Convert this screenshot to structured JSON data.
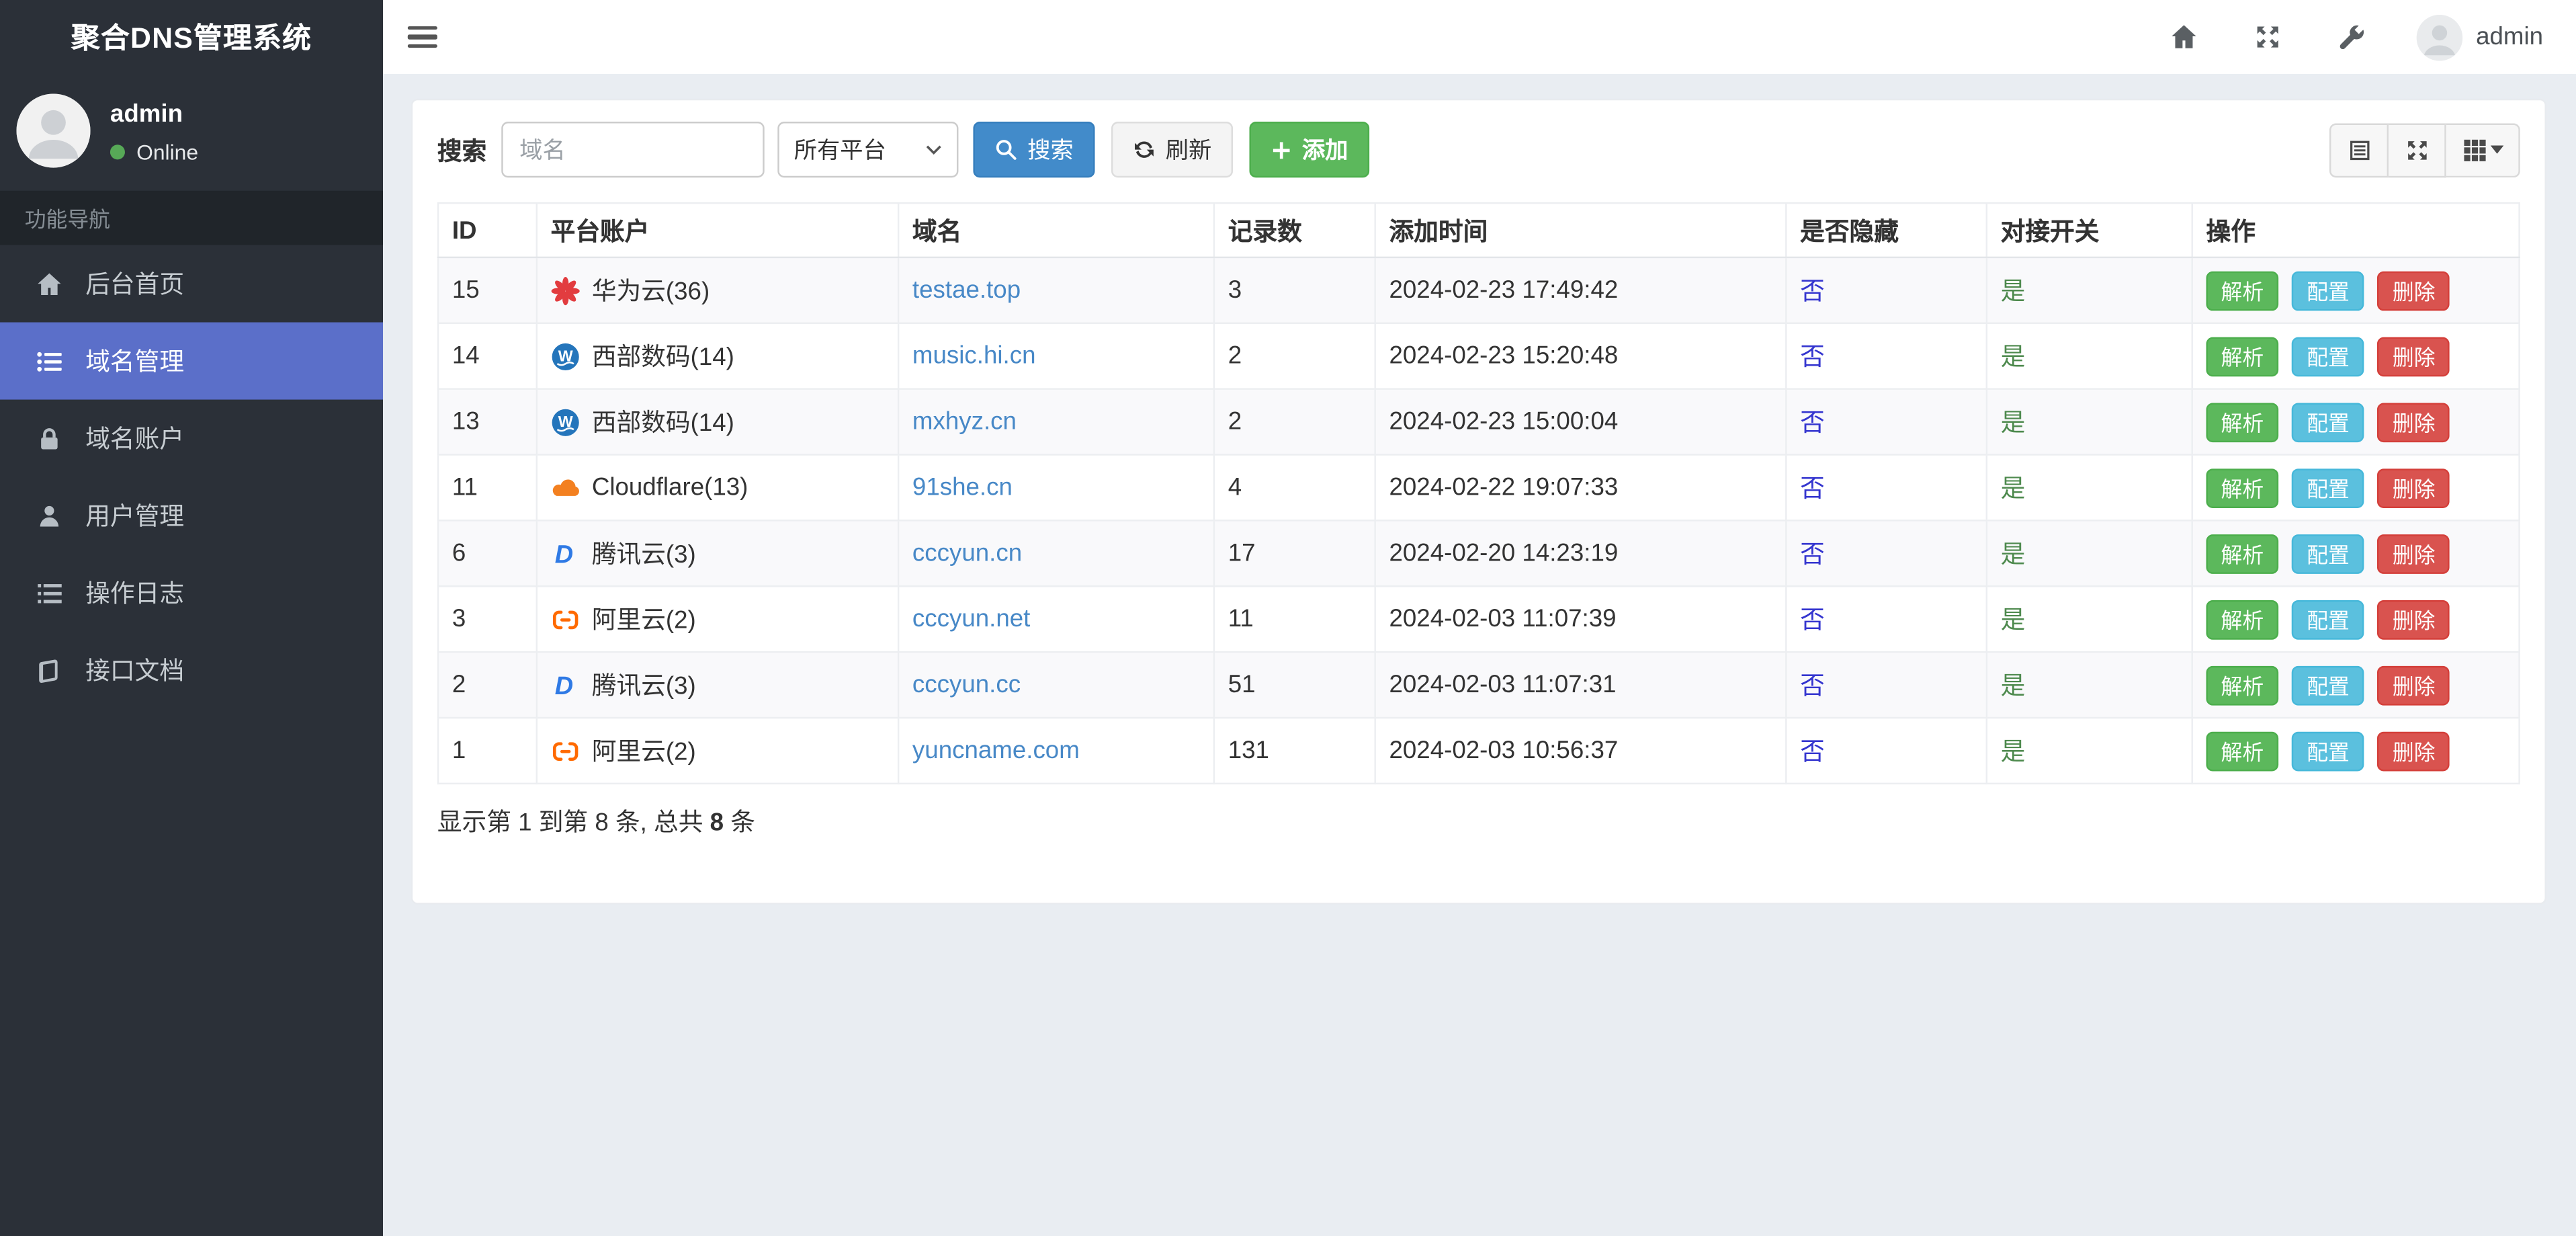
{
  "app_title": "聚合DNS管理系统",
  "topbar": {
    "user_name": "admin"
  },
  "sidebar": {
    "user_name": "admin",
    "user_status": "Online",
    "section_label": "功能导航",
    "items": [
      {
        "label": "后台首页",
        "icon": "home-icon",
        "active": false
      },
      {
        "label": "域名管理",
        "icon": "list-icon",
        "active": true
      },
      {
        "label": "域名账户",
        "icon": "lock-icon",
        "active": false
      },
      {
        "label": "用户管理",
        "icon": "user-icon",
        "active": false
      },
      {
        "label": "操作日志",
        "icon": "log-icon",
        "active": false
      },
      {
        "label": "接口文档",
        "icon": "doc-icon",
        "active": false
      }
    ]
  },
  "toolbar": {
    "search_label": "搜索",
    "search_placeholder": "域名",
    "platform_filter": "所有平台",
    "search_button": "搜索",
    "refresh_button": "刷新",
    "add_button": "添加"
  },
  "table": {
    "headers": [
      "ID",
      "平台账户",
      "域名",
      "记录数",
      "添加时间",
      "是否隐藏",
      "对接开关",
      "操作"
    ],
    "actions": [
      "解析",
      "配置",
      "删除"
    ],
    "rows": [
      {
        "id": "15",
        "platform": "华为云(36)",
        "platform_icon": "huawei",
        "domain": "testae.top",
        "records": "3",
        "added": "2024-02-23 17:49:42",
        "hidden": "否",
        "enabled": "是"
      },
      {
        "id": "14",
        "platform": "西部数码(14)",
        "platform_icon": "west",
        "domain": "music.hi.cn",
        "records": "2",
        "added": "2024-02-23 15:20:48",
        "hidden": "否",
        "enabled": "是"
      },
      {
        "id": "13",
        "platform": "西部数码(14)",
        "platform_icon": "west",
        "domain": "mxhyz.cn",
        "records": "2",
        "added": "2024-02-23 15:00:04",
        "hidden": "否",
        "enabled": "是"
      },
      {
        "id": "11",
        "platform": "Cloudflare(13)",
        "platform_icon": "cloudflare",
        "domain": "91she.cn",
        "records": "4",
        "added": "2024-02-22 19:07:33",
        "hidden": "否",
        "enabled": "是"
      },
      {
        "id": "6",
        "platform": "腾讯云(3)",
        "platform_icon": "dnspod",
        "domain": "cccyun.cn",
        "records": "17",
        "added": "2024-02-20 14:23:19",
        "hidden": "否",
        "enabled": "是"
      },
      {
        "id": "3",
        "platform": "阿里云(2)",
        "platform_icon": "aliyun",
        "domain": "cccyun.net",
        "records": "11",
        "added": "2024-02-03 11:07:39",
        "hidden": "否",
        "enabled": "是"
      },
      {
        "id": "2",
        "platform": "腾讯云(3)",
        "platform_icon": "dnspod",
        "domain": "cccyun.cc",
        "records": "51",
        "added": "2024-02-03 11:07:31",
        "hidden": "否",
        "enabled": "是"
      },
      {
        "id": "1",
        "platform": "阿里云(2)",
        "platform_icon": "aliyun",
        "domain": "yuncname.com",
        "records": "131",
        "added": "2024-02-03 10:56:37",
        "hidden": "否",
        "enabled": "是"
      }
    ],
    "summary_prefix": "显示第 1 到第 8 条, 总共 ",
    "summary_total": "8",
    "summary_suffix": " 条"
  },
  "colors": {
    "sidebar_bg": "#2b3038",
    "accent_active": "#5b6fc9",
    "primary": "#428bca",
    "success": "#5cb85c",
    "info": "#5bc0de",
    "danger": "#d9534f",
    "link": "#4788c7",
    "hidden_flag": "#3435cf",
    "enabled_flag": "#4e8a4e",
    "online_dot": "#57a957"
  }
}
